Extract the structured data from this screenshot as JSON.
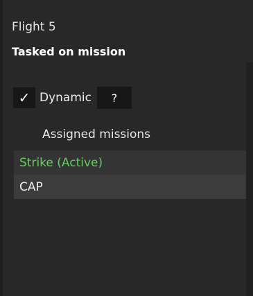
{
  "panel": {
    "title": "Flight 5",
    "subtitle": "Tasked on mission"
  },
  "dynamic": {
    "checked": true,
    "check_glyph": "✓",
    "label": "Dynamic",
    "help_label": "?"
  },
  "missions": {
    "header": "Assigned missions",
    "items": [
      {
        "label": "Strike (Active)",
        "active": true
      },
      {
        "label": "CAP",
        "active": false
      }
    ]
  },
  "colors": {
    "active_mission_text": "#63cc5e",
    "panel_bg": "#282828"
  }
}
